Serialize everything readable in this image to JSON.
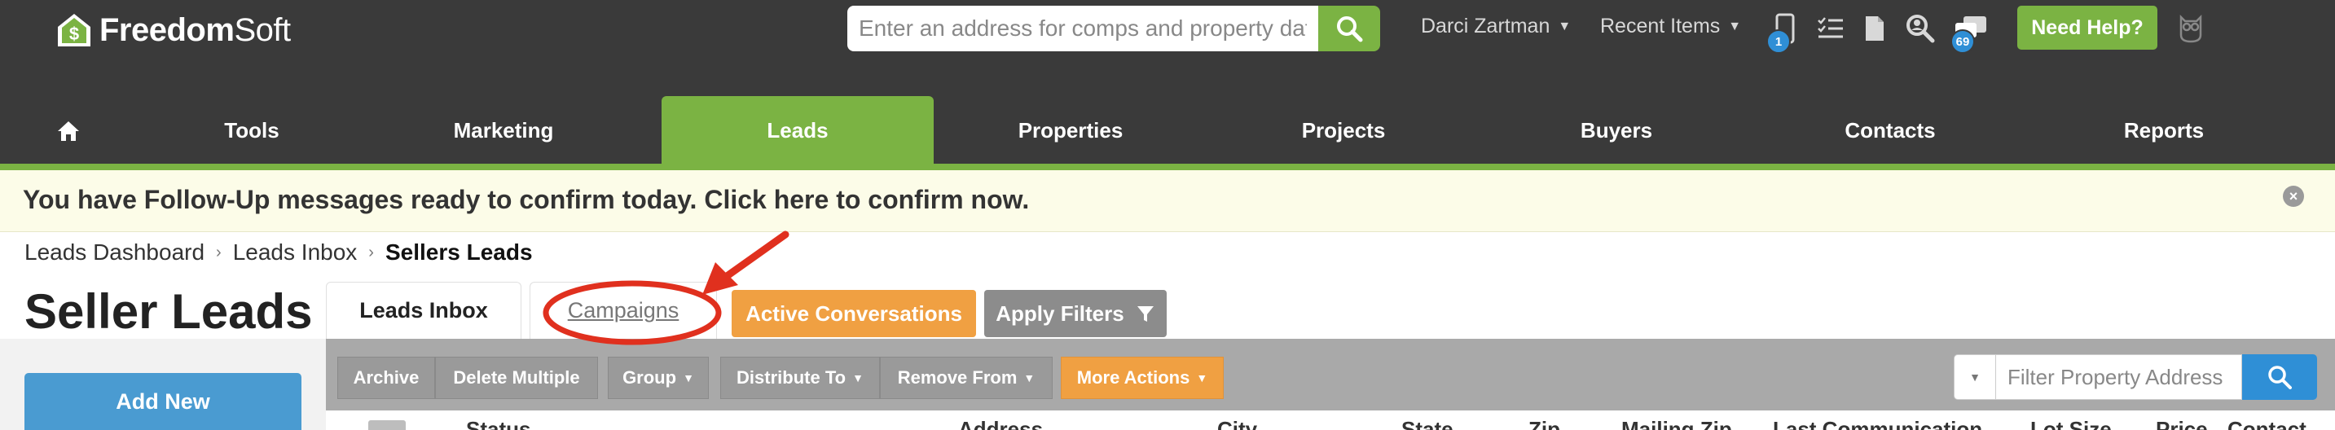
{
  "app": {
    "logo_text_bold": "Freedom",
    "logo_text_light": "Soft"
  },
  "header": {
    "search": {
      "placeholder": "Enter an address for comps and property data"
    },
    "user_name": "Darci Zartman",
    "recent_items_label": "Recent Items",
    "phone_badge": "1",
    "chat_badge": "69",
    "need_help_label": "Need Help?",
    "icons": [
      "home-icon",
      "search-icon",
      "phone-icon",
      "checklist-icon",
      "document-icon",
      "search-person-icon",
      "chat-icon",
      "owl-icon"
    ]
  },
  "nav": {
    "items": [
      {
        "label": "Tools"
      },
      {
        "label": "Marketing"
      },
      {
        "label": "Leads",
        "active": true
      },
      {
        "label": "Properties"
      },
      {
        "label": "Projects"
      },
      {
        "label": "Buyers"
      },
      {
        "label": "Contacts"
      },
      {
        "label": "Reports"
      }
    ]
  },
  "notice": {
    "text": "You have Follow-Up messages ready to confirm today. Click here to confirm now.",
    "close_symbol": "×"
  },
  "breadcrumb": {
    "items": [
      "Leads Dashboard",
      "Leads Inbox",
      "Sellers Leads"
    ],
    "separator": "›"
  },
  "page": {
    "title": "Seller Leads"
  },
  "tabs": {
    "inbox": "Leads Inbox",
    "campaigns": "Campaigns"
  },
  "buttons": {
    "active_conversations": "Active Conversations",
    "apply_filters": "Apply Filters",
    "add_new": "Add New"
  },
  "toolbar": {
    "archive": "Archive",
    "delete_multiple": "Delete Multiple",
    "group": "Group",
    "distribute_to": "Distribute To",
    "remove_from": "Remove From",
    "more_actions": "More Actions",
    "filter_placeholder": "Filter Property Address"
  },
  "table": {
    "columns": [
      "Status",
      "Address",
      "City",
      "State",
      "Zip",
      "Mailing Zip",
      "Last Communication",
      "Lot Size",
      "Price",
      "Contact"
    ]
  },
  "colors": {
    "header_bg": "#3a3a3a",
    "accent_green": "#7bb343",
    "orange": "#f0a042",
    "blue": "#2f8fd6",
    "annotation_red": "#e0301e"
  }
}
